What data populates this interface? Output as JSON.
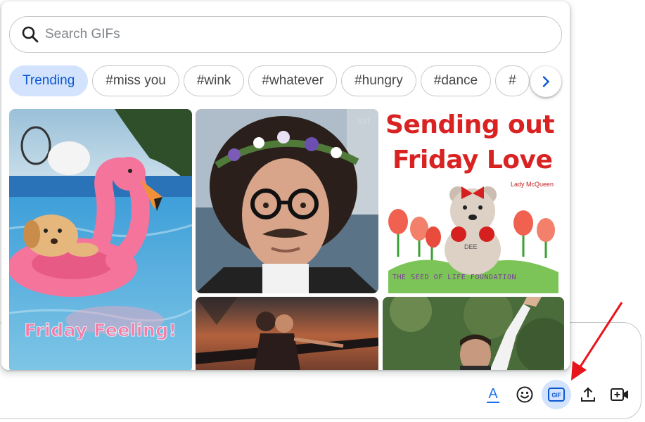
{
  "search": {
    "placeholder": "Search GIFs",
    "value": ""
  },
  "chips": [
    {
      "label": "Trending",
      "selected": true
    },
    {
      "label": "#miss you"
    },
    {
      "label": "#wink"
    },
    {
      "label": "#whatever"
    },
    {
      "label": "#hungry"
    },
    {
      "label": "#dance"
    },
    {
      "label": "#"
    }
  ],
  "gifs": {
    "flamingo": {
      "caption": "Friday Feeling!"
    },
    "friday_love": {
      "line1": "Sending out",
      "line2": "Friday Love",
      "credit": "Lady McQueen",
      "footer": "THE SEED OF LIFE FOUNDATION",
      "bear_tag": "DEE"
    },
    "svt_watermark": "svt"
  },
  "toolbar": {
    "format_label": "A",
    "gif_label": "GIF"
  },
  "colors": {
    "accent": "#0b57d0",
    "chip_selected_bg": "#d3e3fd",
    "annotation_arrow": "#e8141b"
  }
}
